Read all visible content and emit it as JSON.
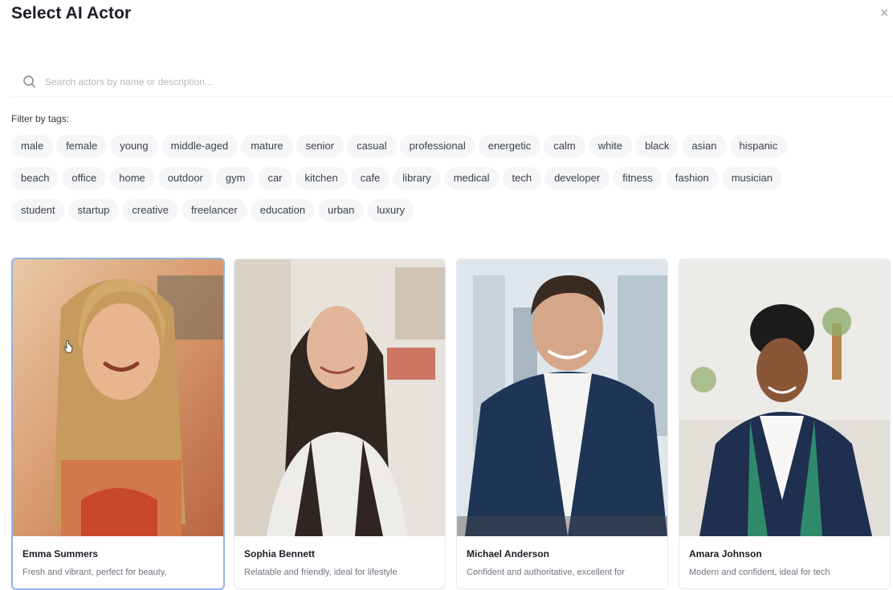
{
  "dialog": {
    "title": "Select AI Actor",
    "close_glyph": "×"
  },
  "search": {
    "placeholder": "Search actors by name or description...",
    "icon": "search-icon"
  },
  "filter": {
    "label": "Filter by tags:",
    "rows": [
      [
        "male",
        "female",
        "young",
        "middle-aged",
        "mature",
        "senior",
        "casual",
        "professional",
        "energetic",
        "calm",
        "white",
        "black",
        "asian",
        "hispanic"
      ],
      [
        "beach",
        "office",
        "home",
        "outdoor",
        "gym",
        "car",
        "kitchen",
        "cafe",
        "library",
        "medical",
        "tech",
        "developer",
        "fitness",
        "fashion",
        "musician"
      ],
      [
        "student",
        "startup",
        "creative",
        "freelancer",
        "education",
        "urban",
        "luxury"
      ]
    ]
  },
  "actors": [
    {
      "name": "Emma Summers",
      "description": "Fresh and vibrant, perfect for beauty,",
      "selected": true
    },
    {
      "name": "Sophia Bennett",
      "description": "Relatable and friendly, ideal for lifestyle",
      "selected": false
    },
    {
      "name": "Michael Anderson",
      "description": "Confident and authoritative, excellent for",
      "selected": false
    },
    {
      "name": "Amara Johnson",
      "description": "Modern and confident, ideal for tech",
      "selected": false
    }
  ],
  "colors": {
    "selected_border": "#8fb4e8",
    "tag_bg": "#f5f6f8"
  }
}
